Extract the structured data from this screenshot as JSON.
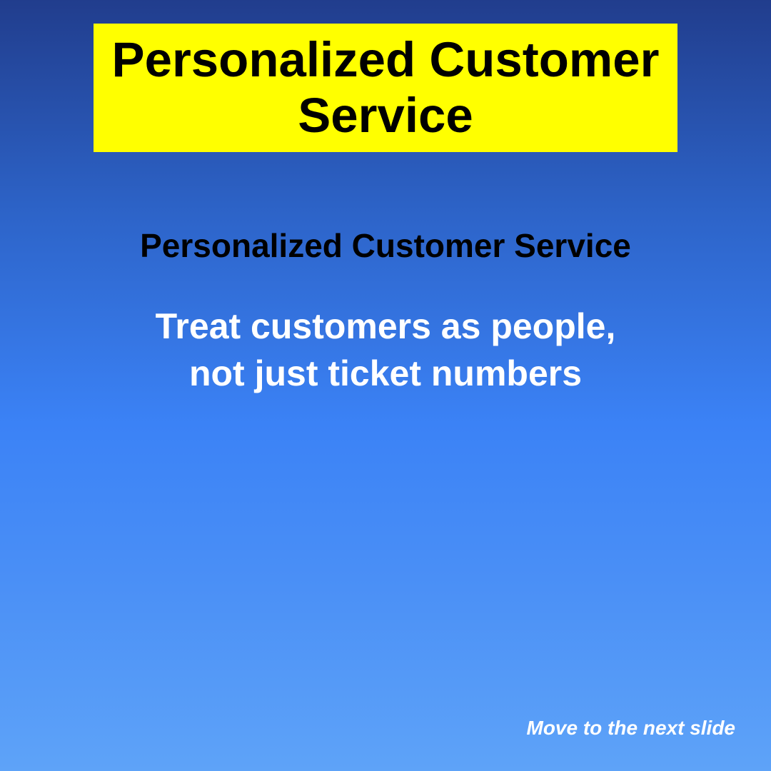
{
  "slide": {
    "title": "Personalized Customer Service",
    "subtitle": "Personalized Customer Service",
    "body_lines": [
      "Treat customers as people,",
      "not just ticket numbers"
    ],
    "next_label": "Move to the next slide"
  },
  "colors": {
    "title_background": "#ffff00",
    "background_top": "#213d8d",
    "background_bottom": "#5ea3f8",
    "body_text": "#ffffff",
    "heading_text": "#000000"
  }
}
